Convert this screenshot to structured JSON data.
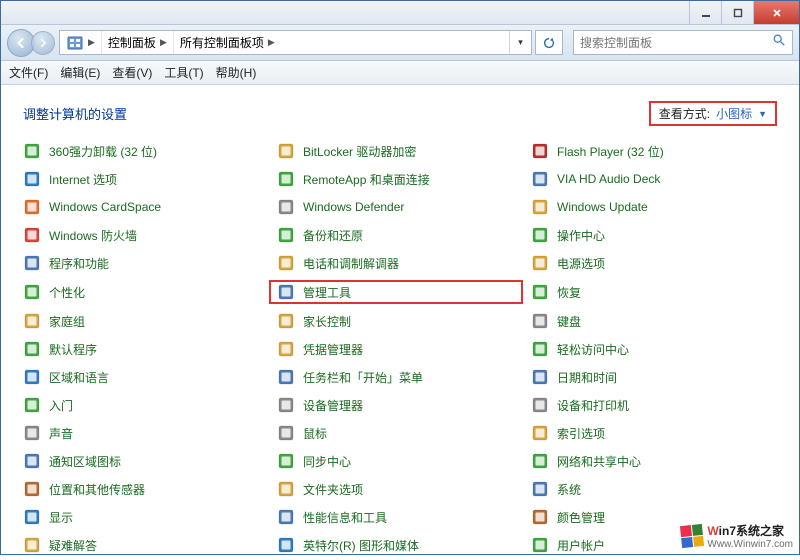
{
  "breadcrumb": {
    "root_icon": "panel",
    "seg1": "控制面板",
    "seg2": "所有控制面板项"
  },
  "search": {
    "placeholder": "搜索控制面板"
  },
  "menu": {
    "file": "文件(F)",
    "edit": "编辑(E)",
    "view": "查看(V)",
    "tools": "工具(T)",
    "help": "帮助(H)"
  },
  "header": {
    "title": "调整计算机的设置",
    "view_label": "查看方式:",
    "view_value": "小图标"
  },
  "columns": [
    [
      {
        "icon": "uninstall",
        "label": "360强力卸载 (32 位)"
      },
      {
        "icon": "globe",
        "label": "Internet 选项"
      },
      {
        "icon": "cardspace",
        "label": "Windows CardSpace"
      },
      {
        "icon": "firewall",
        "label": "Windows 防火墙"
      },
      {
        "icon": "programs",
        "label": "程序和功能"
      },
      {
        "icon": "personal",
        "label": "个性化"
      },
      {
        "icon": "homegroup",
        "label": "家庭组"
      },
      {
        "icon": "default",
        "label": "默认程序"
      },
      {
        "icon": "region",
        "label": "区域和语言"
      },
      {
        "icon": "getstart",
        "label": "入门"
      },
      {
        "icon": "sound",
        "label": "声音"
      },
      {
        "icon": "notify",
        "label": "通知区域图标"
      },
      {
        "icon": "location",
        "label": "位置和其他传感器"
      },
      {
        "icon": "display",
        "label": "显示"
      },
      {
        "icon": "trouble",
        "label": "疑难解答"
      }
    ],
    [
      {
        "icon": "bitlocker",
        "label": "BitLocker 驱动器加密"
      },
      {
        "icon": "remoteapp",
        "label": "RemoteApp 和桌面连接"
      },
      {
        "icon": "defender",
        "label": "Windows Defender"
      },
      {
        "icon": "backup",
        "label": "备份和还原"
      },
      {
        "icon": "phone",
        "label": "电话和调制解调器"
      },
      {
        "icon": "admintool",
        "label": "管理工具",
        "highlight": true
      },
      {
        "icon": "parental",
        "label": "家长控制"
      },
      {
        "icon": "credential",
        "label": "凭据管理器"
      },
      {
        "icon": "taskbar",
        "label": "任务栏和「开始」菜单"
      },
      {
        "icon": "devmgr",
        "label": "设备管理器"
      },
      {
        "icon": "mouse",
        "label": "鼠标"
      },
      {
        "icon": "sync",
        "label": "同步中心"
      },
      {
        "icon": "folderopt",
        "label": "文件夹选项"
      },
      {
        "icon": "perfinfo",
        "label": "性能信息和工具"
      },
      {
        "icon": "realtek",
        "label": "英特尔(R) 图形和媒体"
      }
    ],
    [
      {
        "icon": "flash",
        "label": "Flash Player (32 位)"
      },
      {
        "icon": "audiodeck",
        "label": "VIA HD Audio Deck"
      },
      {
        "icon": "winupdate",
        "label": "Windows Update"
      },
      {
        "icon": "action",
        "label": "操作中心"
      },
      {
        "icon": "power",
        "label": "电源选项"
      },
      {
        "icon": "recovery",
        "label": "恢复"
      },
      {
        "icon": "keyboard",
        "label": "键盘"
      },
      {
        "icon": "ease",
        "label": "轻松访问中心"
      },
      {
        "icon": "datetime",
        "label": "日期和时间"
      },
      {
        "icon": "devprint",
        "label": "设备和打印机"
      },
      {
        "icon": "indexing",
        "label": "索引选项"
      },
      {
        "icon": "netshare",
        "label": "网络和共享中心"
      },
      {
        "icon": "system",
        "label": "系统"
      },
      {
        "icon": "color",
        "label": "颜色管理"
      },
      {
        "icon": "useracct",
        "label": "用户帐户"
      }
    ]
  ],
  "watermark": {
    "line1_a": "W",
    "line1_b": "in7系统之家",
    "line2": "Www.Winwin7.com"
  },
  "icon_colors": {
    "uninstall": "#3fa83f",
    "globe": "#2d7cc8",
    "cardspace": "#e46b2f",
    "firewall": "#d8443a",
    "programs": "#4a7ab8",
    "personal": "#3fa83f",
    "homegroup": "#d8a63a",
    "default": "#3fa83f",
    "region": "#2d7cc8",
    "getstart": "#3fa83f",
    "sound": "#8a8a8a",
    "notify": "#4a7ab8",
    "location": "#b86a2d",
    "display": "#2d7cc8",
    "trouble": "#d8a63a",
    "bitlocker": "#d8a63a",
    "remoteapp": "#3fa83f",
    "defender": "#8a8a8a",
    "backup": "#3fa83f",
    "phone": "#d8a63a",
    "admintool": "#4a7ab8",
    "parental": "#d8a63a",
    "credential": "#d8a63a",
    "taskbar": "#4a7ab8",
    "devmgr": "#8a8a8a",
    "mouse": "#8a8a8a",
    "sync": "#3fa83f",
    "folderopt": "#d8a63a",
    "perfinfo": "#4a7ab8",
    "realtek": "#2d7cc8",
    "flash": "#b82f2f",
    "audiodeck": "#4a7ab8",
    "winupdate": "#d8a63a",
    "action": "#3fa83f",
    "power": "#d8a63a",
    "recovery": "#3fa83f",
    "keyboard": "#8a8a8a",
    "ease": "#3fa83f",
    "datetime": "#4a7ab8",
    "devprint": "#8a8a8a",
    "indexing": "#d8a63a",
    "netshare": "#3fa83f",
    "system": "#4a7ab8",
    "color": "#b86a2d",
    "useracct": "#3fa83f"
  }
}
